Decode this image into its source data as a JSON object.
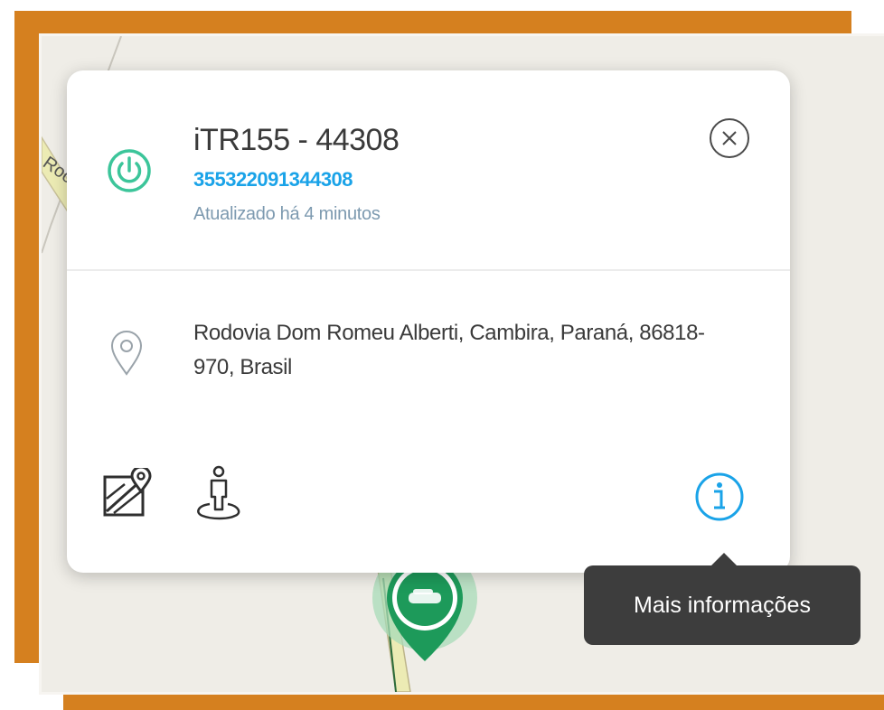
{
  "device": {
    "title": "iTR155 - 44308",
    "imei": "355322091344308",
    "updated": "Atualizado há 4 minutos",
    "status_icon": "power-icon",
    "status_color": "#3cc59a"
  },
  "location": {
    "icon": "location-pin-icon",
    "address": "Rodovia Dom Romeu Alberti, Cambira, Paraná, 86818-970, Brasil"
  },
  "actions": {
    "close_icon": "close-icon",
    "map_icon": "map-icon",
    "street_view_icon": "street-view-icon",
    "info_icon": "info-icon",
    "info_color": "#1aa3e8"
  },
  "tooltip": {
    "text": "Mais informações"
  },
  "map": {
    "road_label": "Roc",
    "marker_color": "#1d9a5a"
  }
}
